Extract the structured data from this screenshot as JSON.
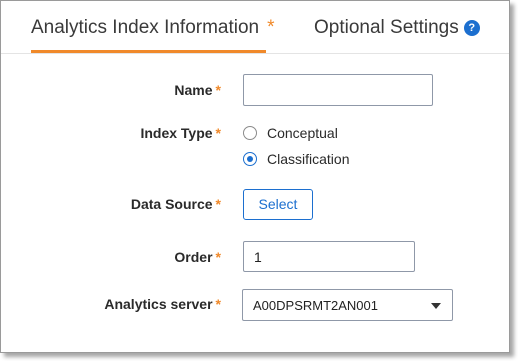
{
  "tabs": {
    "active_label": "Analytics Index Information",
    "active_required": "*",
    "optional_label": "Optional Settings",
    "help_glyph": "?"
  },
  "colors": {
    "accent": "#f0892a",
    "primary": "#1c6fcf"
  },
  "form": {
    "required_mark": "*",
    "name": {
      "label": "Name",
      "value": ""
    },
    "index_type": {
      "label": "Index Type",
      "options": [
        {
          "label": "Conceptual",
          "selected": false
        },
        {
          "label": "Classification",
          "selected": true
        }
      ]
    },
    "data_source": {
      "label": "Data Source",
      "button_label": "Select"
    },
    "order": {
      "label": "Order",
      "value": "1"
    },
    "analytics_server": {
      "label": "Analytics server",
      "value": "A00DPSRMT2AN001"
    }
  }
}
